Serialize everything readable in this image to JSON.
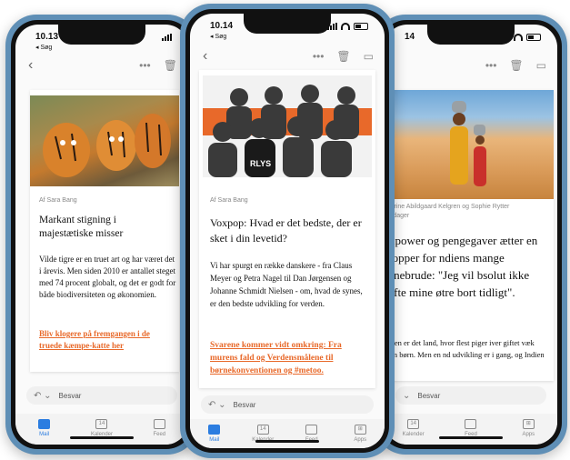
{
  "left_phone": {
    "time": "10.13",
    "back_app": "◂ Søg",
    "byline": "Af Sara Bang",
    "headline": "Markant stigning i majestætiske misser",
    "body": "Vilde tigre er en truet art og har været det i årevis. Men siden 2010 er antallet steget med 74 procent globalt, og det er godt for både biodiversiteten og økonomien.",
    "link": "Bliv klogere på fremgangen i de truede kæmpe-katte her",
    "reply_placeholder": "Besvar",
    "tabs": [
      "Mail",
      "Kalender",
      "Feed"
    ]
  },
  "center_phone": {
    "time": "10.14",
    "back_app": "◂ Søg",
    "byline": "Af Sara Bang",
    "photo_text": "RLYS",
    "headline": "Voxpop: Hvad er det bedste, der er sket i din levetid?",
    "body": "Vi har spurgt en række danskere - fra Claus Meyer og Petra Nagel til Dan Jørgensen og Johanne Schmidt Nielsen - om, hvad de synes, er den bedste udvikling for verden.",
    "link": "Svarene kommer vidt omkring: Fra murens fald og Verdensmålene til børnekonventionen og #metoo.",
    "reply_placeholder": "Besvar",
    "tabs": [
      "Mail",
      "Kalender",
      "Feed",
      "Apps"
    ],
    "calendar_day": "14"
  },
  "right_phone": {
    "time": "14",
    "byline": "Katrine Abildgaard Kelgren og Sophie Rytter holdager",
    "headline": "irlpower og pengegaver ætter en stopper for ndiens mange arnebrude: \"Jeg vil bsolut ikke gifte mine øtre bort tidligt\".",
    "body": "ndien er det land, hvor flest piger iver giftet væk som børn. Men en nd udvikling er i gang, og Indien er",
    "reply_placeholder": "Besvar",
    "tabs": [
      "Kalender",
      "Feed",
      "Apps"
    ],
    "calendar_day": "14"
  },
  "colors": {
    "accent_orange": "#e8692a",
    "tab_active_blue": "#2b7de0",
    "phone_frame": "#5f8fb6"
  }
}
